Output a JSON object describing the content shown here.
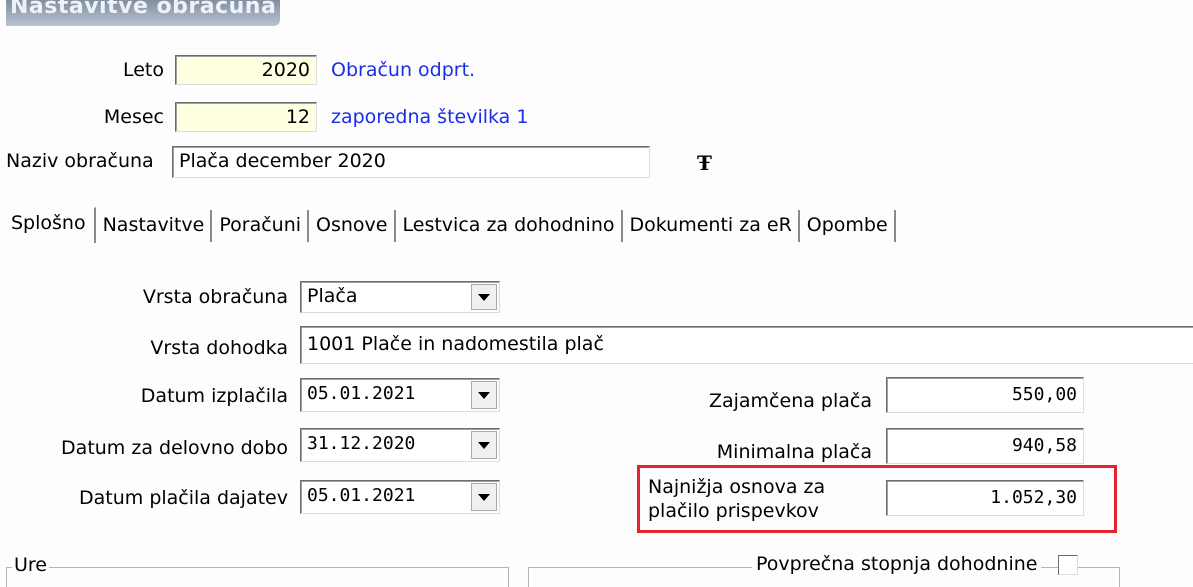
{
  "window": {
    "title": "Nastavitve obračuna"
  },
  "header": {
    "year_label": "Leto",
    "year_value": "2020",
    "year_status": "Obračun odprt.",
    "month_label": "Mesec",
    "month_value": "12",
    "sequence_text": "zaporedna številka 1",
    "name_label": "Naziv obračuna",
    "name_value": "Plača december 2020",
    "text_format_icon": "TT-font-icon"
  },
  "tabs": [
    {
      "label": "Splošno",
      "active": true
    },
    {
      "label": "Nastavitve"
    },
    {
      "label": "Poračuni"
    },
    {
      "label": "Osnove"
    },
    {
      "label": "Lestvica za dohodnino"
    },
    {
      "label": "Dokumenti za eR"
    },
    {
      "label": "Opombe"
    }
  ],
  "general": {
    "type_label": "Vrsta obračuna",
    "type_value": "Plača",
    "income_label": "Vrsta dohodka",
    "income_value": "1001  Plače in nadomestila plač",
    "pay_date_label": "Datum izplačila",
    "pay_date_value": "05.01.2021",
    "work_date_label": "Datum za delovno dobo",
    "work_date_value": "31.12.2020",
    "tax_date_label": "Datum plačila dajatev",
    "tax_date_value": "05.01.2021",
    "guaranteed_label": "Zajamčena plača",
    "guaranteed_value": "550,00",
    "minimum_label": "Minimalna plača",
    "minimum_value": "940,58",
    "lowest_base_label_1": "Najnižja osnova za",
    "lowest_base_label_2": "plačilo prispevkov",
    "lowest_base_value": "1.052,30",
    "avg_tax_label": "Povprečna stopnja dohodnine",
    "hours_group_label": "Ure"
  },
  "colors": {
    "highlight_border": "#e5222f",
    "status_text": "#1a2ee6",
    "input_yellow": "#ffffe1"
  }
}
